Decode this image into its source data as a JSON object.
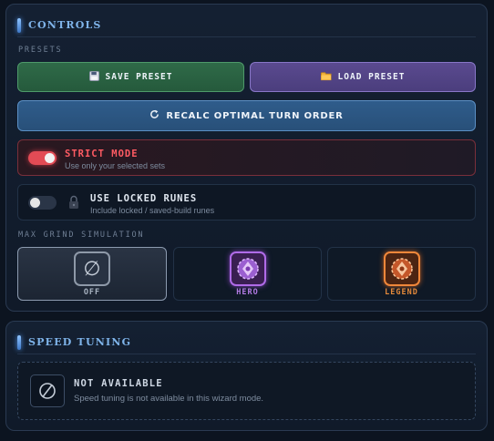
{
  "controls": {
    "title": "CONTROLS",
    "presets_label": "PRESETS",
    "save_label": "SAVE PRESET",
    "save_icon": "floppy-disk-icon",
    "load_label": "LOAD PRESET",
    "load_icon": "folder-icon",
    "recalc_label": "RECALC OPTIMAL TURN ORDER",
    "recalc_icon": "refresh-icon",
    "strict_mode": {
      "title": "STRICT MODE",
      "subtitle": "Use only your selected sets",
      "enabled": true
    },
    "locked_runes": {
      "title": "USE LOCKED RUNES",
      "subtitle": "Include locked / saved-build runes",
      "enabled": false
    },
    "max_grind_label": "MAX GRIND SIMULATION",
    "grind_options": [
      {
        "label": "OFF",
        "glyph": "∅",
        "selected": true
      },
      {
        "label": "HERO",
        "selected": false
      },
      {
        "label": "LEGEND",
        "selected": false
      }
    ]
  },
  "speed_tuning": {
    "title": "SPEED TUNING",
    "not_available_title": "NOT AVAILABLE",
    "not_available_text": "Speed tuning is not available in this wizard mode."
  },
  "colors": {
    "accent_blue": "#7fb4ea",
    "strict_red": "#ff5b63",
    "hero_purple": "#b27be3",
    "legend_orange": "#e58a3b",
    "save_green": "#2f6a48",
    "load_purple": "#5a4a8f"
  }
}
